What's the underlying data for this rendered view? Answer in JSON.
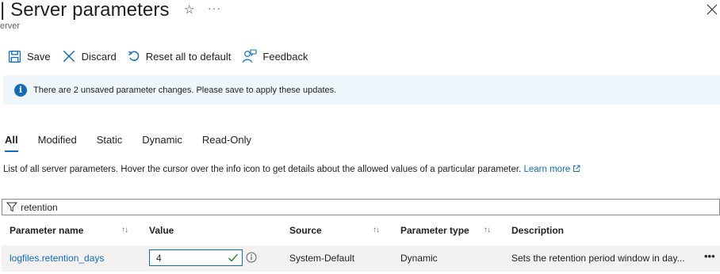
{
  "header": {
    "title": "| Server parameters",
    "star_icon": "☆",
    "more_label": "···",
    "subtitle": "erver"
  },
  "toolbar": {
    "save_label": "Save",
    "discard_label": "Discard",
    "reset_label": "Reset all to default",
    "feedback_label": "Feedback"
  },
  "banner": {
    "icon": "i",
    "text": "There are 2 unsaved parameter changes.  Please save to apply these updates."
  },
  "tabs": [
    {
      "label": "All",
      "active": true
    },
    {
      "label": "Modified",
      "active": false
    },
    {
      "label": "Static",
      "active": false
    },
    {
      "label": "Dynamic",
      "active": false
    },
    {
      "label": "Read-Only",
      "active": false
    }
  ],
  "description": {
    "text": "List of all server parameters. Hover the cursor over the info icon to get details about the allowed values of a particular parameter. ",
    "link_label": "Learn more"
  },
  "filter": {
    "value": "retention"
  },
  "table": {
    "columns": {
      "name": "Parameter name",
      "value": "Value",
      "source": "Source",
      "type": "Parameter type",
      "description": "Description"
    },
    "sort_icon": "↑↓",
    "rows": [
      {
        "name": "logfiles.retention_days",
        "value": "4",
        "source": "System-Default",
        "type": "Dynamic",
        "description": "Sets the retention period window in day...",
        "more": "•••"
      }
    ]
  },
  "colors": {
    "accent": "#0f6cbd",
    "banner_bg": "#eff6fc",
    "row_bg": "#f3f2f1",
    "valid_check": "#107c10"
  }
}
